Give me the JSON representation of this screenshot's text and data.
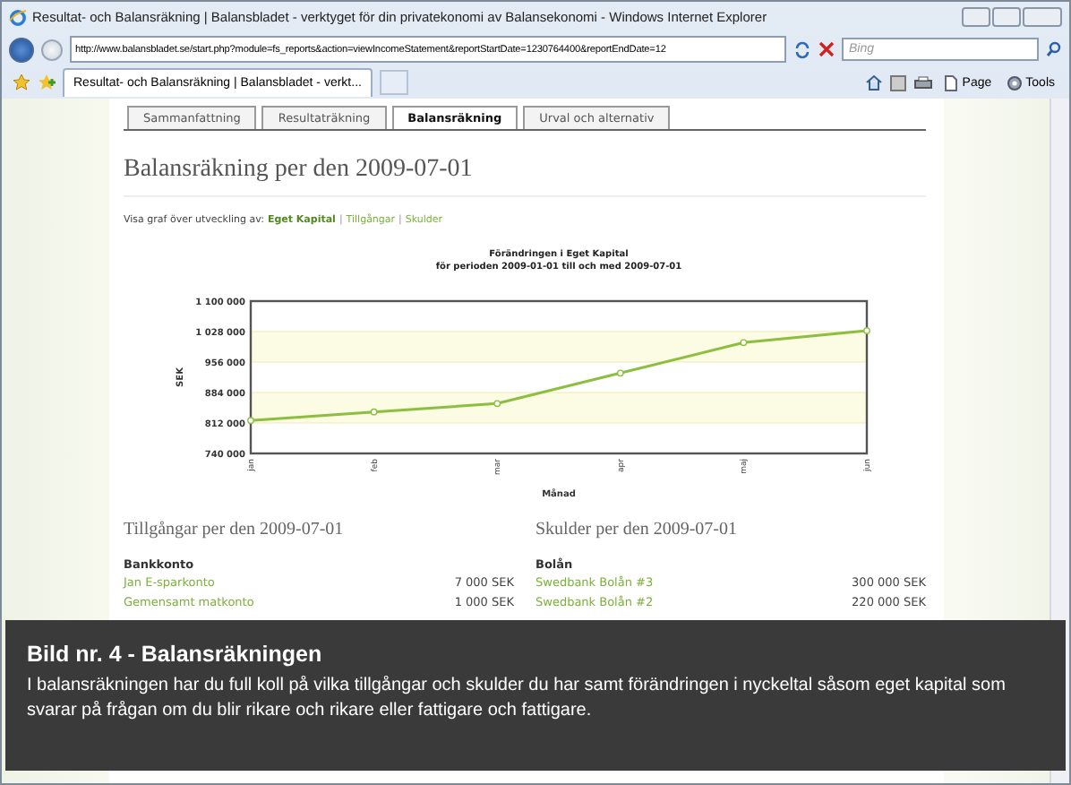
{
  "window": {
    "title": "Resultat- och Balansräkning | Balansbladet - verktyget för din privatekonomi av Balansekonomi - Windows Internet Explorer"
  },
  "address_bar": {
    "url": "http://www.balansbladet.se/start.php?module=fs_reports&action=viewIncomeStatement&reportStartDate=1230764400&reportEndDate=12"
  },
  "search": {
    "placeholder": "Bing"
  },
  "browser_tab": {
    "label": "Resultat- och Balansräkning | Balansbladet - verkt..."
  },
  "command_bar": [
    {
      "label": "Page",
      "kind": "page"
    },
    {
      "label": "Tools",
      "kind": "tools"
    }
  ],
  "tabs": [
    {
      "label": "Sammanfattning",
      "selected": false
    },
    {
      "label": "Resultaträkning",
      "selected": false
    },
    {
      "label": "Balansräkning",
      "selected": true
    },
    {
      "label": "Urval och alternativ",
      "selected": false
    }
  ],
  "heading": "Balansräkning per den 2009-07-01",
  "graph_links": {
    "prefix": "Visa graf över utveckling av:",
    "separator": "|",
    "links": [
      {
        "label": "Eget Kapital",
        "selected": true
      },
      {
        "label": "Tillgångar",
        "selected": false
      },
      {
        "label": "Skulder",
        "selected": false
      }
    ]
  },
  "chart": {
    "chart_data": {
      "type": "line",
      "title": "Förändringen i Eget Kapital\nför perioden 2009-01-01 till och med 2009-07-01",
      "xlabel": "Månad",
      "ylabel": "SEK",
      "categories": [
        "jan",
        "feb",
        "mar",
        "apr",
        "maj",
        "jun"
      ],
      "grid": true,
      "series": [
        {
          "color": "#8cbf3f",
          "marker": "o",
          "values": [
            818000,
            838000,
            858000,
            930000,
            1002000,
            1030000
          ]
        }
      ],
      "ylim": [
        740000,
        1100000
      ],
      "yticks": [
        {
          "value": 740000,
          "label": "740 000"
        },
        {
          "value": 812000,
          "label": "812 000"
        },
        {
          "value": 884000,
          "label": "884 000"
        },
        {
          "value": 956000,
          "label": "956 000"
        },
        {
          "value": 1028000,
          "label": "1 028 000"
        },
        {
          "value": 1100000,
          "label": "1 100 000"
        }
      ]
    }
  },
  "tables": [
    {
      "title": "Tillgångar per den 2009-07-01",
      "groups": [
        {
          "heading": "Bankkonto",
          "rows": [
            {
              "kind": "link",
              "label": "Jan E-sparkonto",
              "amount": "7 000 SEK"
            },
            {
              "kind": "link",
              "label": "Gemensamt matkonto",
              "amount": "1 000 SEK"
            }
          ]
        }
      ]
    },
    {
      "title": "Skulder per den 2009-07-01",
      "groups": [
        {
          "heading": "Bolån",
          "rows": [
            {
              "kind": "link",
              "label": "Swedbank Bolån #3",
              "amount": "300 000 SEK"
            },
            {
              "kind": "link",
              "label": "Swedbank Bolån #2",
              "amount": "220 000 SEK"
            }
          ]
        }
      ]
    }
  ],
  "caption": {
    "title": "Bild nr. 4 - Balansräkningen",
    "text": "I balansräkningen har du full koll på vilka tillgångar och skulder du har samt förändringen i nyckeltal såsom eget kapital som svarar på frågan om du blir rikare och rikare eller fattigare och fattigare."
  }
}
